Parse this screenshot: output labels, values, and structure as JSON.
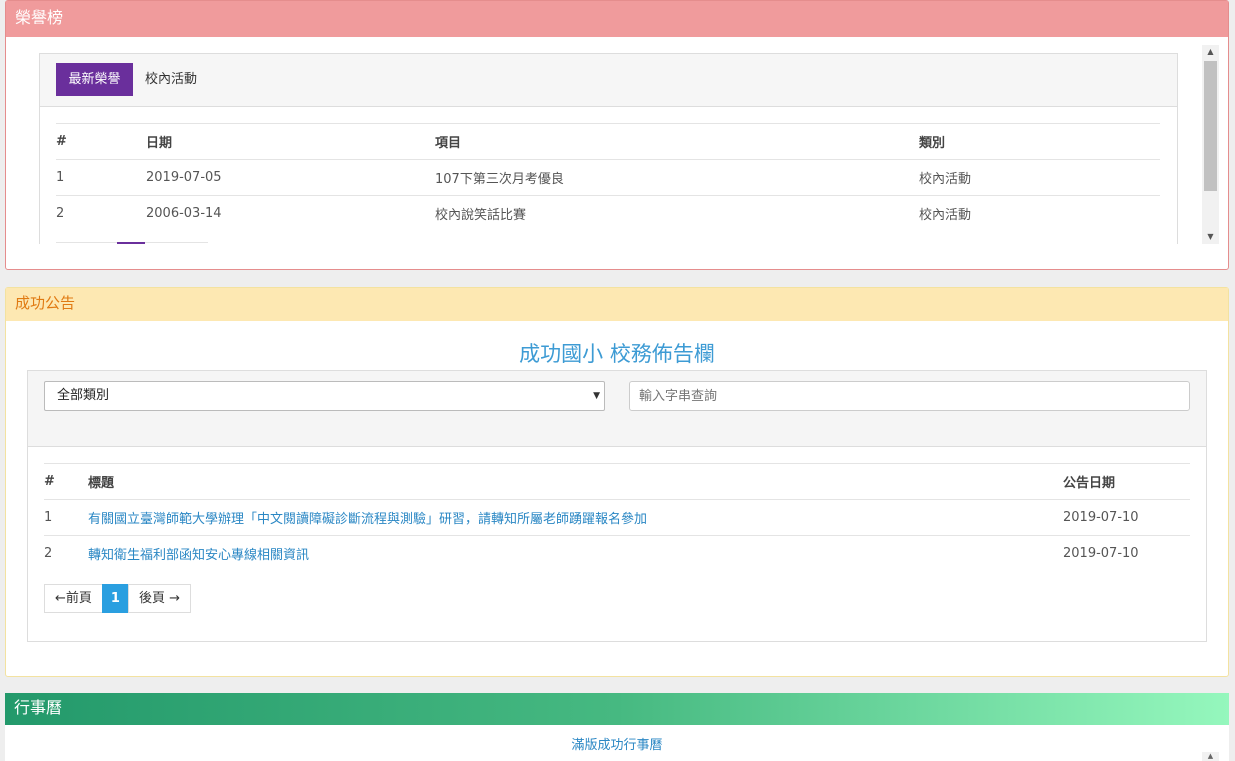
{
  "honor": {
    "header": "榮譽榜",
    "tabs": [
      {
        "label": "最新榮譽",
        "active": true
      },
      {
        "label": "校內活動",
        "active": false
      }
    ],
    "columns": [
      "#",
      "日期",
      "項目",
      "類別"
    ],
    "rows": [
      {
        "num": "1",
        "date": "2019-07-05",
        "item": "107下第三次月考優良",
        "category": "校內活動"
      },
      {
        "num": "2",
        "date": "2006-03-14",
        "item": "校內說笑話比賽",
        "category": "校內活動"
      }
    ],
    "accent": "#6a2f9c"
  },
  "announcements": {
    "header": "成功公告",
    "title": "成功國小 校務佈告欄",
    "category_select": "全部類別",
    "search_placeholder": "輸入字串查詢",
    "columns": [
      "#",
      "標題",
      "公告日期"
    ],
    "rows": [
      {
        "num": "1",
        "title": "有關國立臺灣師範大學辦理「中文閱讀障礙診斷流程與測驗」研習，請轉知所屬老師踴躍報名參加",
        "date": "2019-07-10"
      },
      {
        "num": "2",
        "title": "轉知衛生福利部函知安心專線相關資訊",
        "date": "2019-07-10"
      }
    ],
    "pager": {
      "prev": "←前頁",
      "current": "1",
      "next": "後頁 →"
    }
  },
  "calendar": {
    "header": "行事曆",
    "link": "滿版成功行事曆"
  }
}
